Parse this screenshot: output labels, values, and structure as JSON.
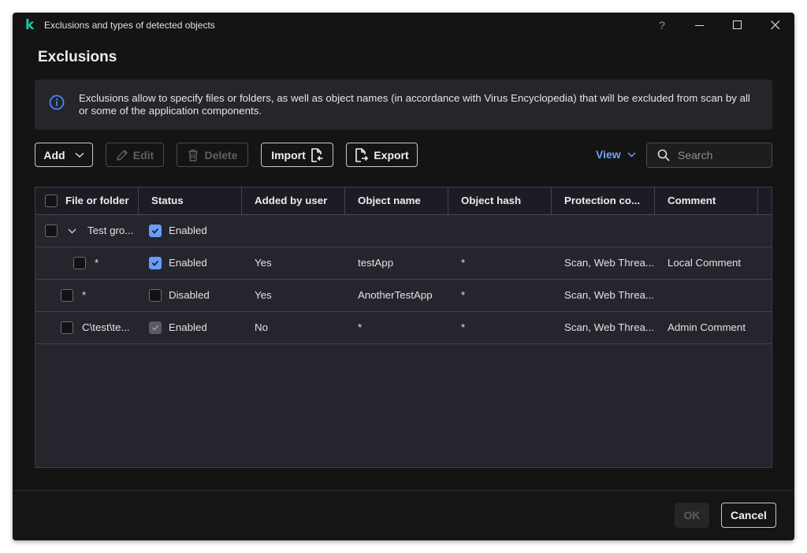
{
  "window": {
    "title": "Exclusions and types of detected objects",
    "logo": "k",
    "controls": {
      "help": "?",
      "minimize": "minimize-icon",
      "maximize": "maximize-icon",
      "close": "close-icon"
    }
  },
  "page_title": "Exclusions",
  "info": {
    "icon": "info-icon",
    "text": "Exclusions allow to specify files or folders, as well as object names (in accordance with Virus Encyclopedia) that will be excluded from scan by all or some of the application components."
  },
  "toolbar": {
    "add_label": "Add",
    "edit_label": "Edit",
    "delete_label": "Delete",
    "import_label": "Import",
    "export_label": "Export",
    "view_label": "View",
    "search_placeholder": "Search"
  },
  "colors": {
    "accent": "#6fa3ff",
    "checkbox_checked": "#6a9cf7",
    "logo": "#1ec8a0"
  },
  "table": {
    "columns": [
      "File or folder",
      "Status",
      "Added by user",
      "Object name",
      "Object hash",
      "Protection co...",
      "Comment"
    ],
    "rows": [
      {
        "type": "group",
        "file": "Test gro...",
        "status": "Enabled",
        "status_checked": true,
        "added_by_user": "",
        "object_name": "",
        "object_hash": "",
        "protection": "",
        "comment": "",
        "expanded": true
      },
      {
        "type": "child",
        "file": "*",
        "status": "Enabled",
        "status_checked": true,
        "added_by_user": "Yes",
        "object_name": "testApp",
        "object_hash": "*",
        "protection": "Scan, Web Threa...",
        "comment": "Local Comment"
      },
      {
        "type": "item",
        "file": "*",
        "status": "Disabled",
        "status_checked": false,
        "added_by_user": "Yes",
        "object_name": "AnotherTestApp",
        "object_hash": "*",
        "protection": "Scan, Web Threa...",
        "comment": ""
      },
      {
        "type": "item",
        "file": "C\\test\\te...",
        "status": "Enabled",
        "status_checked": true,
        "status_locked": true,
        "added_by_user": "No",
        "object_name": "*",
        "object_hash": "*",
        "protection": "Scan, Web Threa...",
        "comment": "Admin Comment"
      }
    ]
  },
  "footer": {
    "ok_label": "OK",
    "cancel_label": "Cancel"
  }
}
